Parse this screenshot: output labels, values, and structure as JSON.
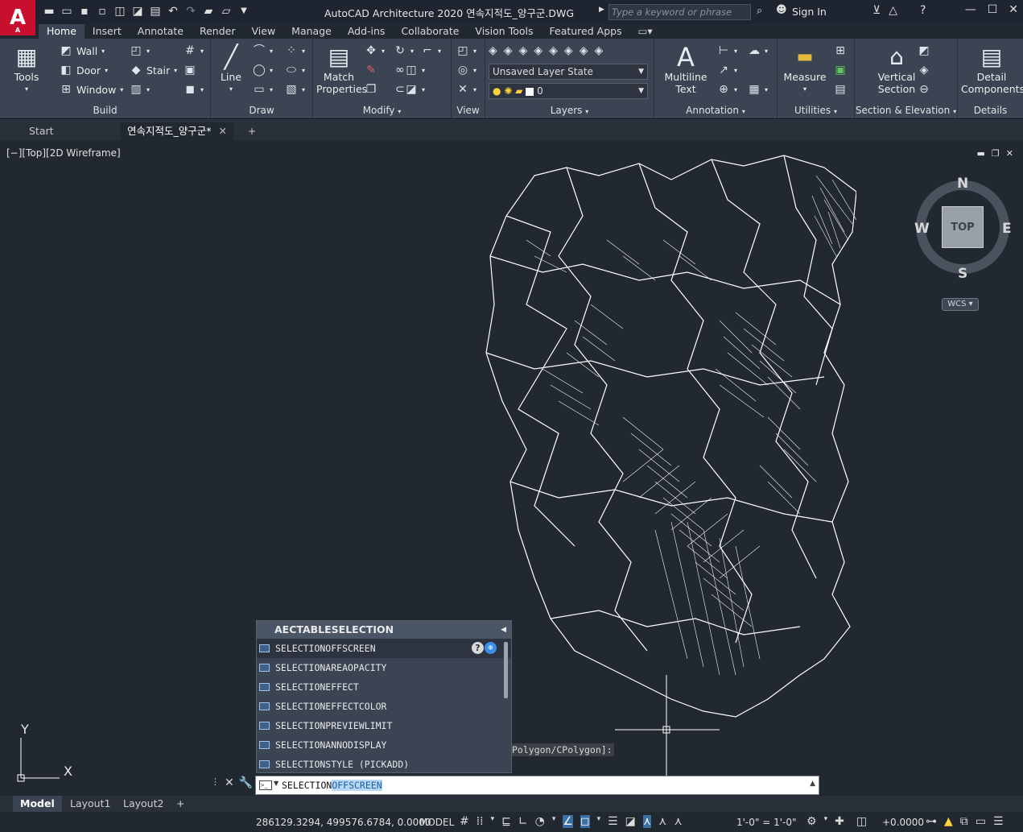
{
  "app": {
    "logo_letter": "A",
    "logo_sub": "A",
    "window_title": "AutoCAD Architecture 2020   연속지적도_양구군.DWG"
  },
  "search": {
    "placeholder": "Type a keyword or phrase"
  },
  "account": {
    "signin_label": "Sign In"
  },
  "ribbon_tabs": [
    "Home",
    "Insert",
    "Annotate",
    "Render",
    "View",
    "Manage",
    "Add-ins",
    "Collaborate",
    "Vision Tools",
    "Featured Apps"
  ],
  "ribbon": {
    "build": {
      "title": "Build",
      "tools_label": "Tools",
      "wall": "Wall",
      "door": "Door",
      "window": "Window",
      "stair": "Stair"
    },
    "draw": {
      "title": "Draw",
      "line": "Line"
    },
    "modify": {
      "title": "Modify",
      "match_properties_1": "Match",
      "match_properties_2": "Properties"
    },
    "view": {
      "title": "View"
    },
    "layers": {
      "title": "Layers",
      "layer_state": "Unsaved Layer State",
      "current_layer": "0"
    },
    "annotation": {
      "title": "Annotation",
      "mtext_1": "Multiline",
      "mtext_2": "Text"
    },
    "utilities": {
      "title": "Utilities",
      "measure": "Measure"
    },
    "section": {
      "title": "Section & Elevation",
      "vsection_1": "Vertical",
      "vsection_2": "Section"
    },
    "details": {
      "title": "Details",
      "detail_1": "Detail",
      "detail_2": "Components"
    }
  },
  "doc_tabs": {
    "start": "Start",
    "drawing": "연속지적도_양구군*"
  },
  "viewport": {
    "label": "[−][Top][2D Wireframe]",
    "viewcube": {
      "north": "N",
      "south": "S",
      "east": "E",
      "west": "W",
      "face": "TOP",
      "ucs": "WCS"
    },
    "ucs_y": "Y",
    "ucs_x": "X"
  },
  "autocomplete": {
    "header": "AECTABLESELECTION",
    "items": [
      "SELECTIONOFFSCREEN",
      "SELECTIONAREAOPACITY",
      "SELECTIONEFFECT",
      "SELECTIONEFFECTCOLOR",
      "SELECTIONPREVIEWLIMIT",
      "SELECTIONANNODISPLAY",
      "SELECTIONSTYLE (PICKADD)"
    ],
    "help_glyph": "?"
  },
  "cmd_history_text": "Polygon/CPolygon]:",
  "command_line": {
    "typed": "SELECTION",
    "completion": "OFFSCREEN"
  },
  "layout_tabs": [
    "Model",
    "Layout1",
    "Layout2"
  ],
  "statusbar": {
    "coords": "286129.3294, 499576.6784, 0.0000",
    "model": "MODEL",
    "scale": "1'-0\" = 1'-0\"",
    "elevation": "+0.0000"
  },
  "colors": {
    "accent": "#c8102e",
    "ribbon_bg": "#3b4453",
    "canvas_bg": "#212830",
    "selection_highlight": "#b9d8f5"
  }
}
